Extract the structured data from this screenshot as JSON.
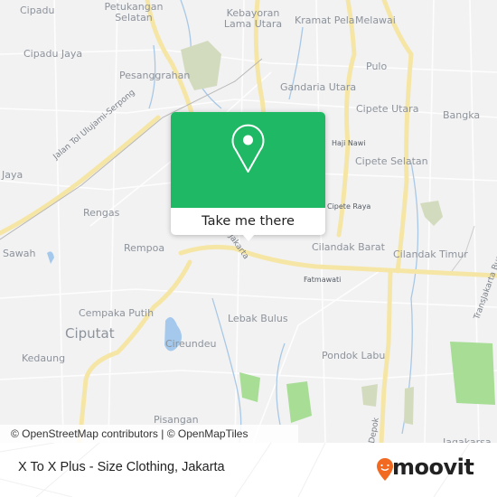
{
  "map": {
    "labels": [
      {
        "text": "Cipadu"
      },
      {
        "text": "Petukangan\nSelatan"
      },
      {
        "text": "Kebayoran\nLama Utara"
      },
      {
        "text": "Kramat Pela"
      },
      {
        "text": "Melawai"
      },
      {
        "text": "Cipadu Jaya"
      },
      {
        "text": "Pesanggrahan"
      },
      {
        "text": "Pulo"
      },
      {
        "text": "Gandaria Utara"
      },
      {
        "text": "Cipete Utara"
      },
      {
        "text": "Bangka"
      },
      {
        "text": "Haji Nawi"
      },
      {
        "text": "Cipete Selatan"
      },
      {
        "text": "Jaya"
      },
      {
        "text": "Rengas"
      },
      {
        "text": "Cipete Raya"
      },
      {
        "text": "Cilandak Barat"
      },
      {
        "text": "Cilandak Timur"
      },
      {
        "text": "Sawah"
      },
      {
        "text": "Rempoa"
      },
      {
        "text": "Fatmawati"
      },
      {
        "text": "Cempaka Putih"
      },
      {
        "text": "Lebak Bulus"
      },
      {
        "text": "Ciputat"
      },
      {
        "text": "Cireundeu"
      },
      {
        "text": "Kedaung"
      },
      {
        "text": "Pondok Labu"
      },
      {
        "text": "Pisangan"
      },
      {
        "text": "Jagakarsa"
      }
    ],
    "road_labels": [
      {
        "text": "Jalan Tol Ulujami-Serpong"
      },
      {
        "text": "Jakarta"
      },
      {
        "text": "Depok"
      },
      {
        "text": "TransJakarta Bus"
      }
    ],
    "attribution": "© OpenStreetMap contributors | © OpenMapTiles"
  },
  "popup": {
    "icon": "location-pin-icon",
    "button_label": "Take me there",
    "color": "#1fb865"
  },
  "footer": {
    "place_title": "X To X Plus - Size Clothing, Jakarta",
    "brand": "moovit",
    "brand_color": "#f26a21"
  }
}
